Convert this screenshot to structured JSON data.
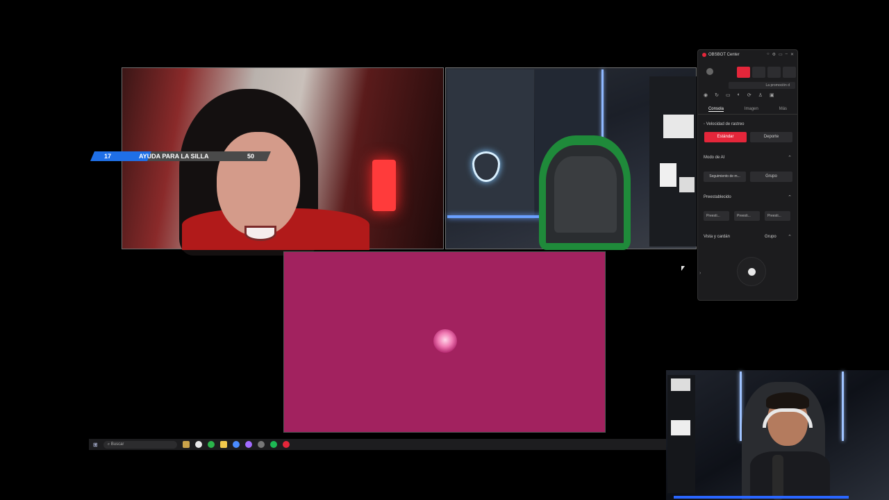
{
  "goal_overlay": {
    "current": "17",
    "title": "AYUDA PARA LA SILLA",
    "target": "50",
    "progress_fraction": 0.34,
    "fill_color": "#1f6fe6"
  },
  "obsbot": {
    "title": "OBSBOT Center",
    "window_controls": [
      "○",
      "⚙",
      "▭",
      "–",
      "✕"
    ],
    "promo_text": "La promoción d",
    "tool_icons": [
      "◉",
      "↻",
      "▭",
      "◐",
      "⟳",
      "♙",
      "▣"
    ],
    "tabs": [
      {
        "label": "Consola",
        "active": true
      },
      {
        "label": "Imagen",
        "active": false
      },
      {
        "label": "Más",
        "active": false
      }
    ],
    "tracking_speed": {
      "label": "Velocidad de rastreo",
      "options": [
        {
          "label": "Estándar",
          "selected": true
        },
        {
          "label": "Deporte",
          "selected": false
        }
      ]
    },
    "ai_mode": {
      "label": "Modo de AI",
      "options": [
        {
          "label": "Seguimiento de m...",
          "selected": false
        },
        {
          "label": "Grupo",
          "selected": false
        }
      ]
    },
    "presets": {
      "label": "Preestablecido",
      "options": [
        "Preesti...",
        "Preesti...",
        "Preesti..."
      ]
    },
    "gimbal": {
      "label": "Vista y cardán",
      "value": "Grupo"
    },
    "accent_color": "#e4263a"
  },
  "taskbar": {
    "start_icon": "windows-icon",
    "search_placeholder": "Buscar"
  }
}
